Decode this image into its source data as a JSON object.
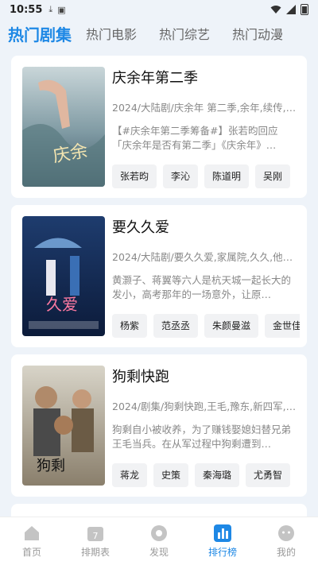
{
  "status": {
    "time": "10:55"
  },
  "tabs": [
    {
      "label": "热门剧集",
      "active": true
    },
    {
      "label": "热门电影",
      "active": false
    },
    {
      "label": "热门综艺",
      "active": false
    },
    {
      "label": "热门动漫",
      "active": false
    }
  ],
  "shows": [
    {
      "title": "庆余年第二季",
      "meta": "2024/大陆剧/庆余年 第二季,余年,续传,…",
      "desc": "【#庆余年第二季筹备#】张若昀回应「庆余年是否有第二季」《庆余年》…",
      "tags": [
        "张若昀",
        "李沁",
        "陈道明",
        "吴刚"
      ]
    },
    {
      "title": "要久久爱",
      "meta": "2024/大陆剧/要久久爱,家属院,久久,他…",
      "desc": "黄灏子、蒋翼等六人是杭天城一起长大的发小，高考那年的一场意外，让原…",
      "tags": [
        "杨紫",
        "范丞丞",
        "朱颜曼滋",
        "金世佳"
      ]
    },
    {
      "title": "狗剩快跑",
      "meta": "2024/剧集/狗剩快跑,王毛,豫东,新四军,…",
      "desc": "狗剩自小被收养，为了赚钱娶媳妇替兄弟王毛当兵。在从军过程中狗剩遭到…",
      "tags": [
        "蒋龙",
        "史策",
        "秦海璐",
        "尤勇智"
      ]
    }
  ],
  "nav": [
    {
      "label": "首页",
      "icon": "home-icon",
      "active": false
    },
    {
      "label": "排期表",
      "icon": "calendar-icon",
      "calendar_day": "7",
      "active": false
    },
    {
      "label": "发现",
      "icon": "discover-icon",
      "active": false
    },
    {
      "label": "排行榜",
      "icon": "ranking-icon",
      "active": true
    },
    {
      "label": "我的",
      "icon": "profile-icon",
      "active": false
    }
  ],
  "colors": {
    "accent": "#1e88e5",
    "background": "#eef3f9",
    "inactive": "#9a9a9a"
  }
}
